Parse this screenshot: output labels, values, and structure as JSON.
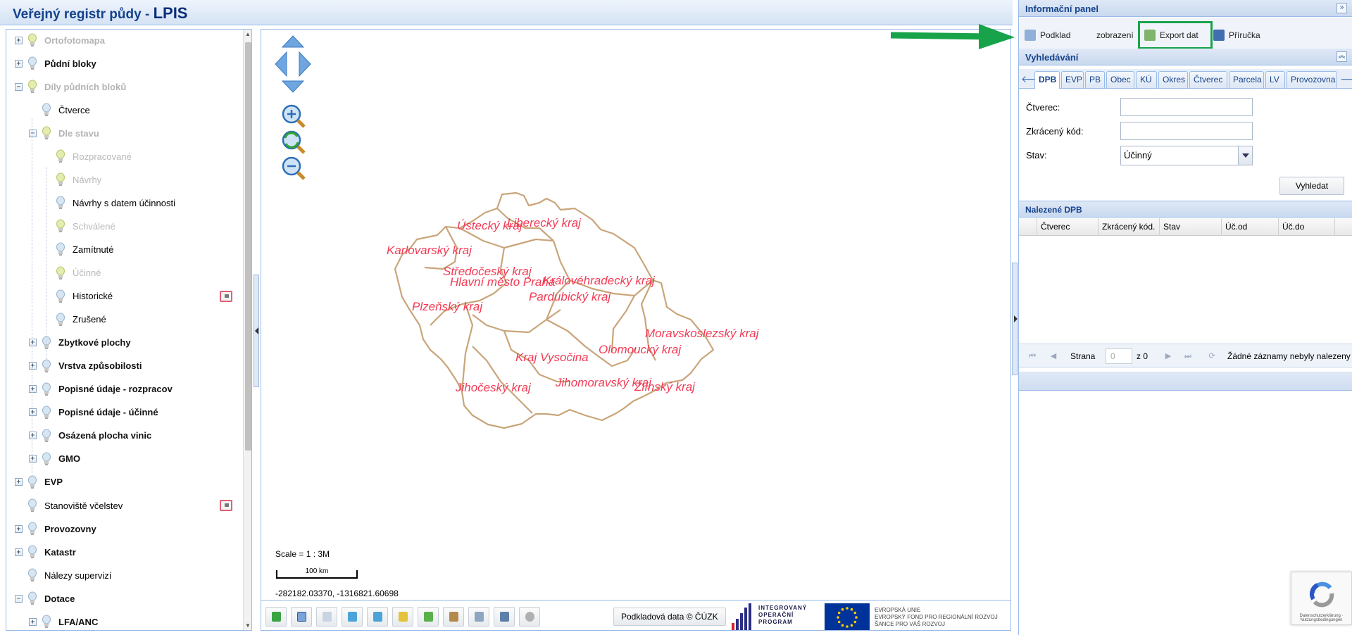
{
  "header": {
    "title_prefix": "Veřejný registr půdy - ",
    "title_brand": "LPIS"
  },
  "tree": {
    "items": [
      {
        "label": "Ortofotomapa",
        "bold": true,
        "muted": true,
        "level": 0,
        "expander": "+"
      },
      {
        "label": "Půdní bloky",
        "bold": true,
        "muted": false,
        "level": 0,
        "expander": "+"
      },
      {
        "label": "Díly půdních bloků",
        "bold": true,
        "muted": true,
        "level": 0,
        "expander": "−"
      },
      {
        "label": "Čtverce",
        "bold": false,
        "muted": false,
        "level": 1,
        "expander": ""
      },
      {
        "label": "Dle stavu",
        "bold": true,
        "muted": true,
        "level": 1,
        "expander": "−"
      },
      {
        "label": "Rozpracované",
        "bold": false,
        "muted": true,
        "level": 2,
        "expander": ""
      },
      {
        "label": "Návrhy",
        "bold": false,
        "muted": true,
        "level": 2,
        "expander": ""
      },
      {
        "label": "Návrhy s datem účinnosti",
        "bold": false,
        "muted": false,
        "level": 2,
        "expander": ""
      },
      {
        "label": "Schválené",
        "bold": false,
        "muted": true,
        "level": 2,
        "expander": ""
      },
      {
        "label": "Zamítnuté",
        "bold": false,
        "muted": false,
        "level": 2,
        "expander": ""
      },
      {
        "label": "Účinné",
        "bold": false,
        "muted": true,
        "level": 2,
        "expander": ""
      },
      {
        "label": "Historické",
        "bold": false,
        "muted": false,
        "level": 2,
        "expander": "",
        "legend": true
      },
      {
        "label": "Zrušené",
        "bold": false,
        "muted": false,
        "level": 2,
        "expander": ""
      },
      {
        "label": "Zbytkové plochy",
        "bold": true,
        "muted": false,
        "level": 1,
        "expander": "+"
      },
      {
        "label": "Vrstva způsobilosti",
        "bold": true,
        "muted": false,
        "level": 1,
        "expander": "+"
      },
      {
        "label": "Popisné údaje - rozpracov",
        "bold": true,
        "muted": false,
        "level": 1,
        "expander": "+"
      },
      {
        "label": "Popisné údaje - účinné",
        "bold": true,
        "muted": false,
        "level": 1,
        "expander": "+"
      },
      {
        "label": "Osázená plocha vinic",
        "bold": true,
        "muted": false,
        "level": 1,
        "expander": "+"
      },
      {
        "label": "GMO",
        "bold": true,
        "muted": false,
        "level": 1,
        "expander": "+"
      },
      {
        "label": "EVP",
        "bold": true,
        "muted": false,
        "level": 0,
        "expander": "+"
      },
      {
        "label": "Stanoviště včelstev",
        "bold": false,
        "muted": false,
        "level": 0,
        "expander": "",
        "legend": true
      },
      {
        "label": "Provozovny",
        "bold": true,
        "muted": false,
        "level": 0,
        "expander": "+"
      },
      {
        "label": "Katastr",
        "bold": true,
        "muted": false,
        "level": 0,
        "expander": "+"
      },
      {
        "label": "Nálezy supervizí",
        "bold": false,
        "muted": false,
        "level": 0,
        "expander": ""
      },
      {
        "label": "Dotace",
        "bold": true,
        "muted": false,
        "level": 0,
        "expander": "−"
      },
      {
        "label": "LFA/ANC",
        "bold": true,
        "muted": false,
        "level": 1,
        "expander": "+"
      }
    ]
  },
  "map": {
    "regions": [
      "Ústecký kraj",
      "Liberecký kraj",
      "Karlovarský kraj",
      "Středočeský kraj",
      "Hlavní město Praha",
      "Královéhradecký kraj",
      "Plzeňský kraj",
      "Pardubický kraj",
      "Moravskoslezský kraj",
      "Olomoucký kraj",
      "Kraj Vysočina",
      "Jihočeský kraj",
      "Jihomoravský kraj",
      "Zlínský kraj"
    ],
    "scale_text": "Scale = 1 : 3M",
    "scalebar_label": "100 km",
    "coords": "-282182.03370, -1316821.60698",
    "copyright": "Podkladová data © ČÚZK",
    "iop_text": [
      "INTEGROVANÝ",
      "OPERAČNÍ",
      "PROGRAM"
    ],
    "eu_text": [
      "EVROPSKÁ UNIE",
      "EVROPSKÝ FOND PRO REGIONÁLNÍ ROZVOJ",
      "ŠANCE PRO VÁŠ ROZVOJ"
    ]
  },
  "info_panel": {
    "title": "Informační panel",
    "toolbar": {
      "podklad": "Podklad",
      "zobrazeni": "zobrazení",
      "export": "Export dat",
      "manual": "Příručka"
    },
    "search_title": "Vyhledávání",
    "tabs": [
      "DPB",
      "EVP",
      "PB",
      "Obec",
      "KÚ",
      "Okres",
      "Čtverec",
      "Parcela",
      "LV",
      "Provozovna"
    ],
    "form": {
      "ctverec_label": "Čtverec:",
      "kod_label": "Zkrácený kód:",
      "stav_label": "Stav:",
      "stav_value": "Účinný",
      "search_button": "Vyhledat"
    },
    "results_title": "Nalezené DPB",
    "columns": [
      "Čtverec",
      "Zkrácený kód.",
      "Stav",
      "Úč.od",
      "Úč.do"
    ],
    "pager": {
      "page_label": "Strana",
      "page_value": "0",
      "of_label": "z 0",
      "status": "Žádné záznamy nebyly nalezeny"
    }
  },
  "recaptcha_text": "Datenschutzerklärung · Nutzungsbedingungen",
  "colors": {
    "header_text": "#15428b",
    "region_labels": "#f23b55",
    "region_borders": "#c9a57a",
    "highlight": "#18a34b"
  }
}
